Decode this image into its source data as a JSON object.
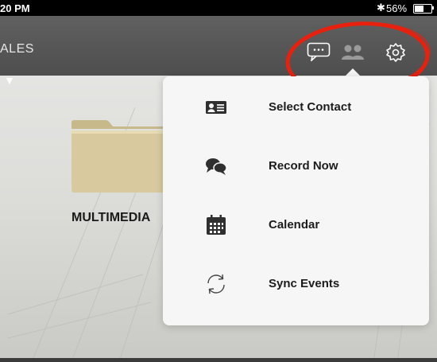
{
  "status_bar": {
    "time": "20 PM",
    "bluetooth_icon": "bluetooth-icon",
    "battery_text": "56%",
    "battery_level_percent": 56
  },
  "nav_bar": {
    "title": "ALES",
    "caret": "▼",
    "icons": [
      "chat-bubble-icon",
      "contacts-icon",
      "gear-icon"
    ]
  },
  "folder": {
    "label": "MULTIMEDIA",
    "icon": "folder-icon"
  },
  "popover_menu": {
    "items": [
      {
        "label": "Select Contact",
        "icon": "contact-card-icon"
      },
      {
        "label": "Record Now",
        "icon": "speech-bubbles-icon"
      },
      {
        "label": "Calendar",
        "icon": "calendar-icon"
      },
      {
        "label": "Sync Events",
        "icon": "sync-icon"
      }
    ]
  },
  "colors": {
    "annotation_red": "#e8210e",
    "folder_tan": "#d6c79a",
    "popover_bg": "#f6f6f6",
    "nav_bg": "#575757"
  }
}
